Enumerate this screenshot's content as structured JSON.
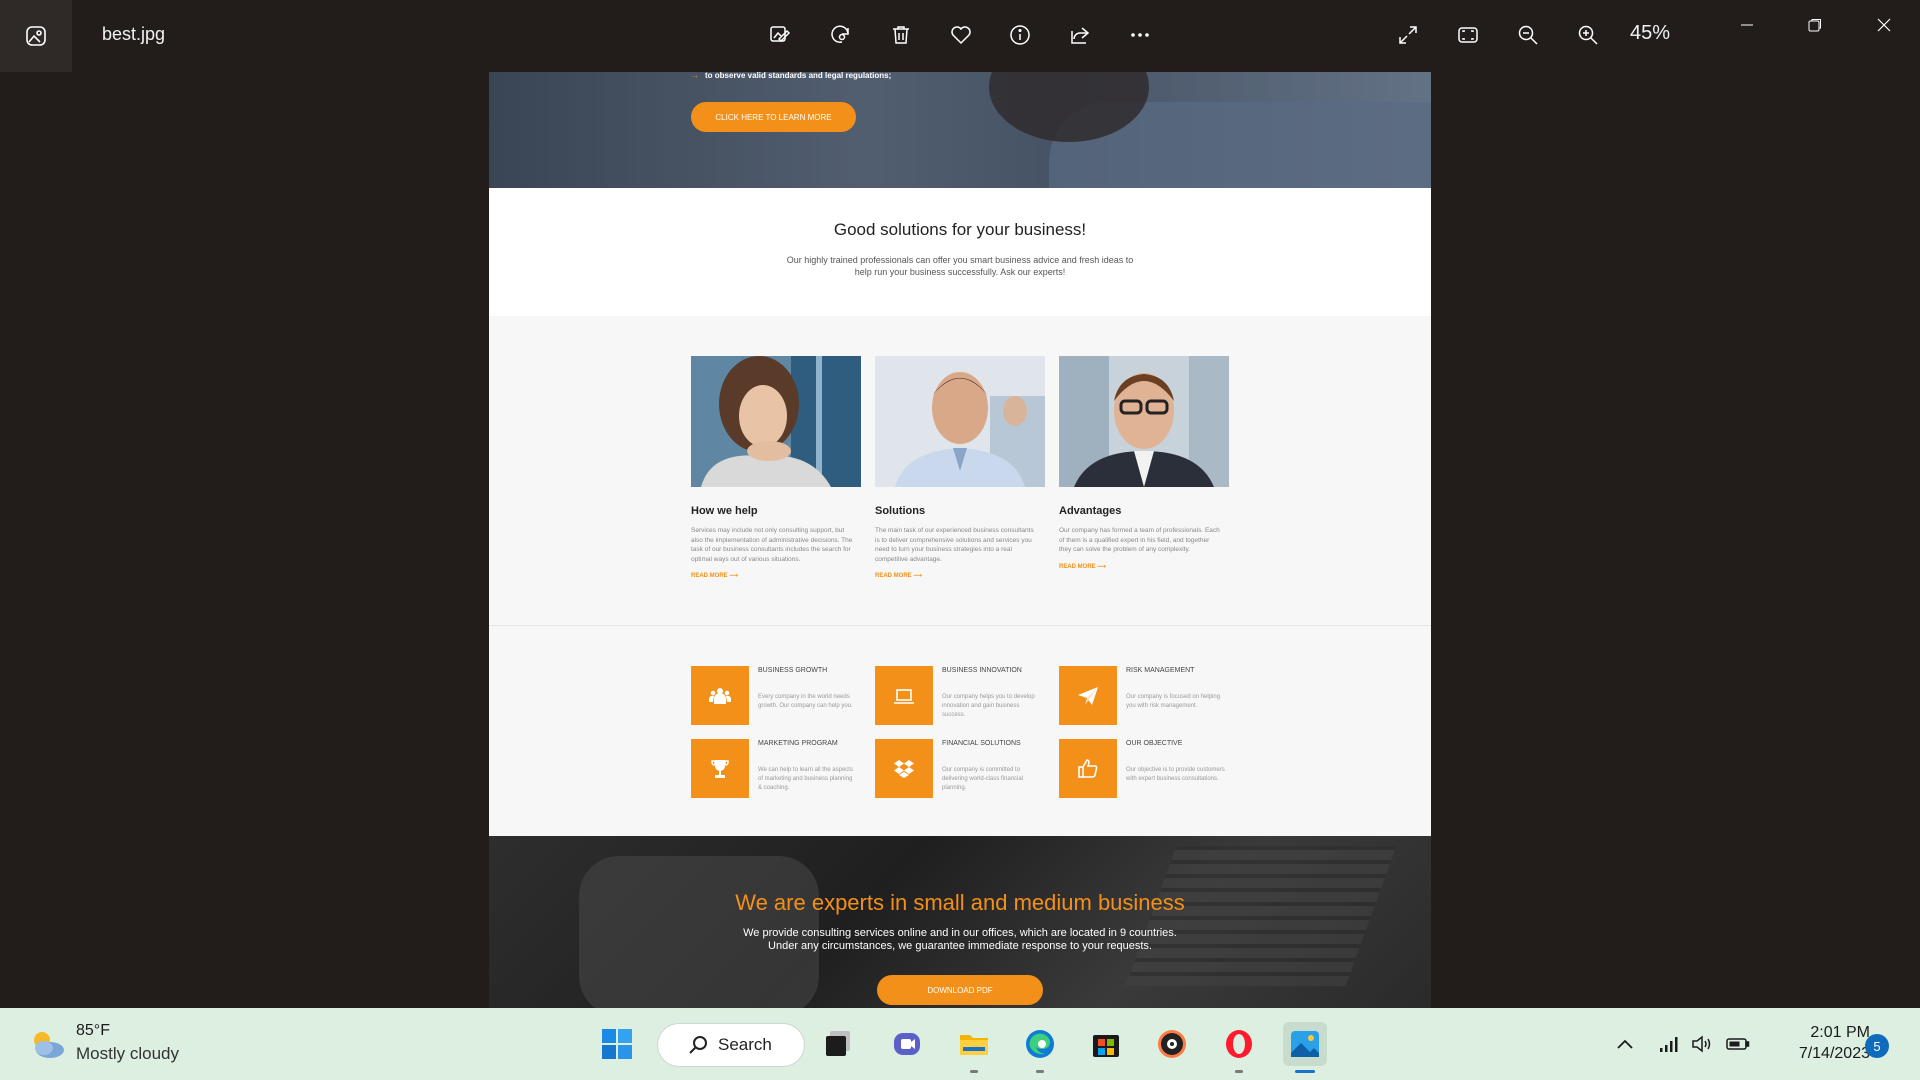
{
  "titlebar": {
    "file_name": "best.jpg",
    "zoom": "45%"
  },
  "document": {
    "hero": {
      "bullet_text": "to observe valid standards and legal regulations;",
      "button": "CLICK HERE TO LEARN MORE"
    },
    "solutions": {
      "title": "Good solutions for your business!",
      "text": "Our highly trained professionals can offer you smart business advice and fresh ideas to help run your business successfully. Ask our experts!"
    },
    "cards": [
      {
        "title": "How we help",
        "text": "Services may include not only consulting support, but also the implementation of administrative decisions. The task of our business consultants includes the search for optimal ways out of various situations.",
        "more": "READ MORE"
      },
      {
        "title": "Solutions",
        "text": "The main task of our experienced business consultants is to deliver comprehensive solutions and services you need to turn your business strategies into a real competitive advantage.",
        "more": "READ MORE"
      },
      {
        "title": "Advantages",
        "text": "Our company has formed a team of professionals. Each of them is a qualified expert in his field, and together they can solve the problem of any complexity.",
        "more": "READ MORE"
      }
    ],
    "features": [
      {
        "title": "BUSINESS GROWTH",
        "text": "Every company in the world needs growth. Our company can help you.",
        "icon": "group-icon"
      },
      {
        "title": "BUSINESS INNOVATION",
        "text": "Our company helps you to develop innovation and gain business success.",
        "icon": "laptop-icon"
      },
      {
        "title": "RISK MANAGEMENT",
        "text": "Our company is focused on helping you with risk management.",
        "icon": "paper-plane-icon"
      },
      {
        "title": "MARKETING PROGRAM",
        "text": "We can help to learn all the aspects of marketing and business planning & coaching.",
        "icon": "trophy-icon"
      },
      {
        "title": "FINANCIAL SOLUTIONS",
        "text": "Our company is committed to delivering world-class financial planning.",
        "icon": "dropbox-icon"
      },
      {
        "title": "OUR OBJECTIVE",
        "text": "Our objective is to provide customers with expert business consultations.",
        "icon": "thumbs-up-icon"
      }
    ],
    "experts": {
      "title": "We are experts in small and medium business",
      "line1": "We provide consulting services online and in our offices, which are located in 9 countries.",
      "line2": "Under any circumstances, we guarantee immediate response to your requests.",
      "button": "DOWNLOAD PDF"
    }
  },
  "taskbar": {
    "weather_temp": "85°F",
    "weather_cond": "Mostly cloudy",
    "search_label": "Search",
    "time": "2:01 PM",
    "date": "7/14/2023",
    "notifications": "5"
  },
  "colors": {
    "accent": "#f39019",
    "titlebar_bg": "#221d1b",
    "taskbar_bg": "#dcefe0"
  }
}
